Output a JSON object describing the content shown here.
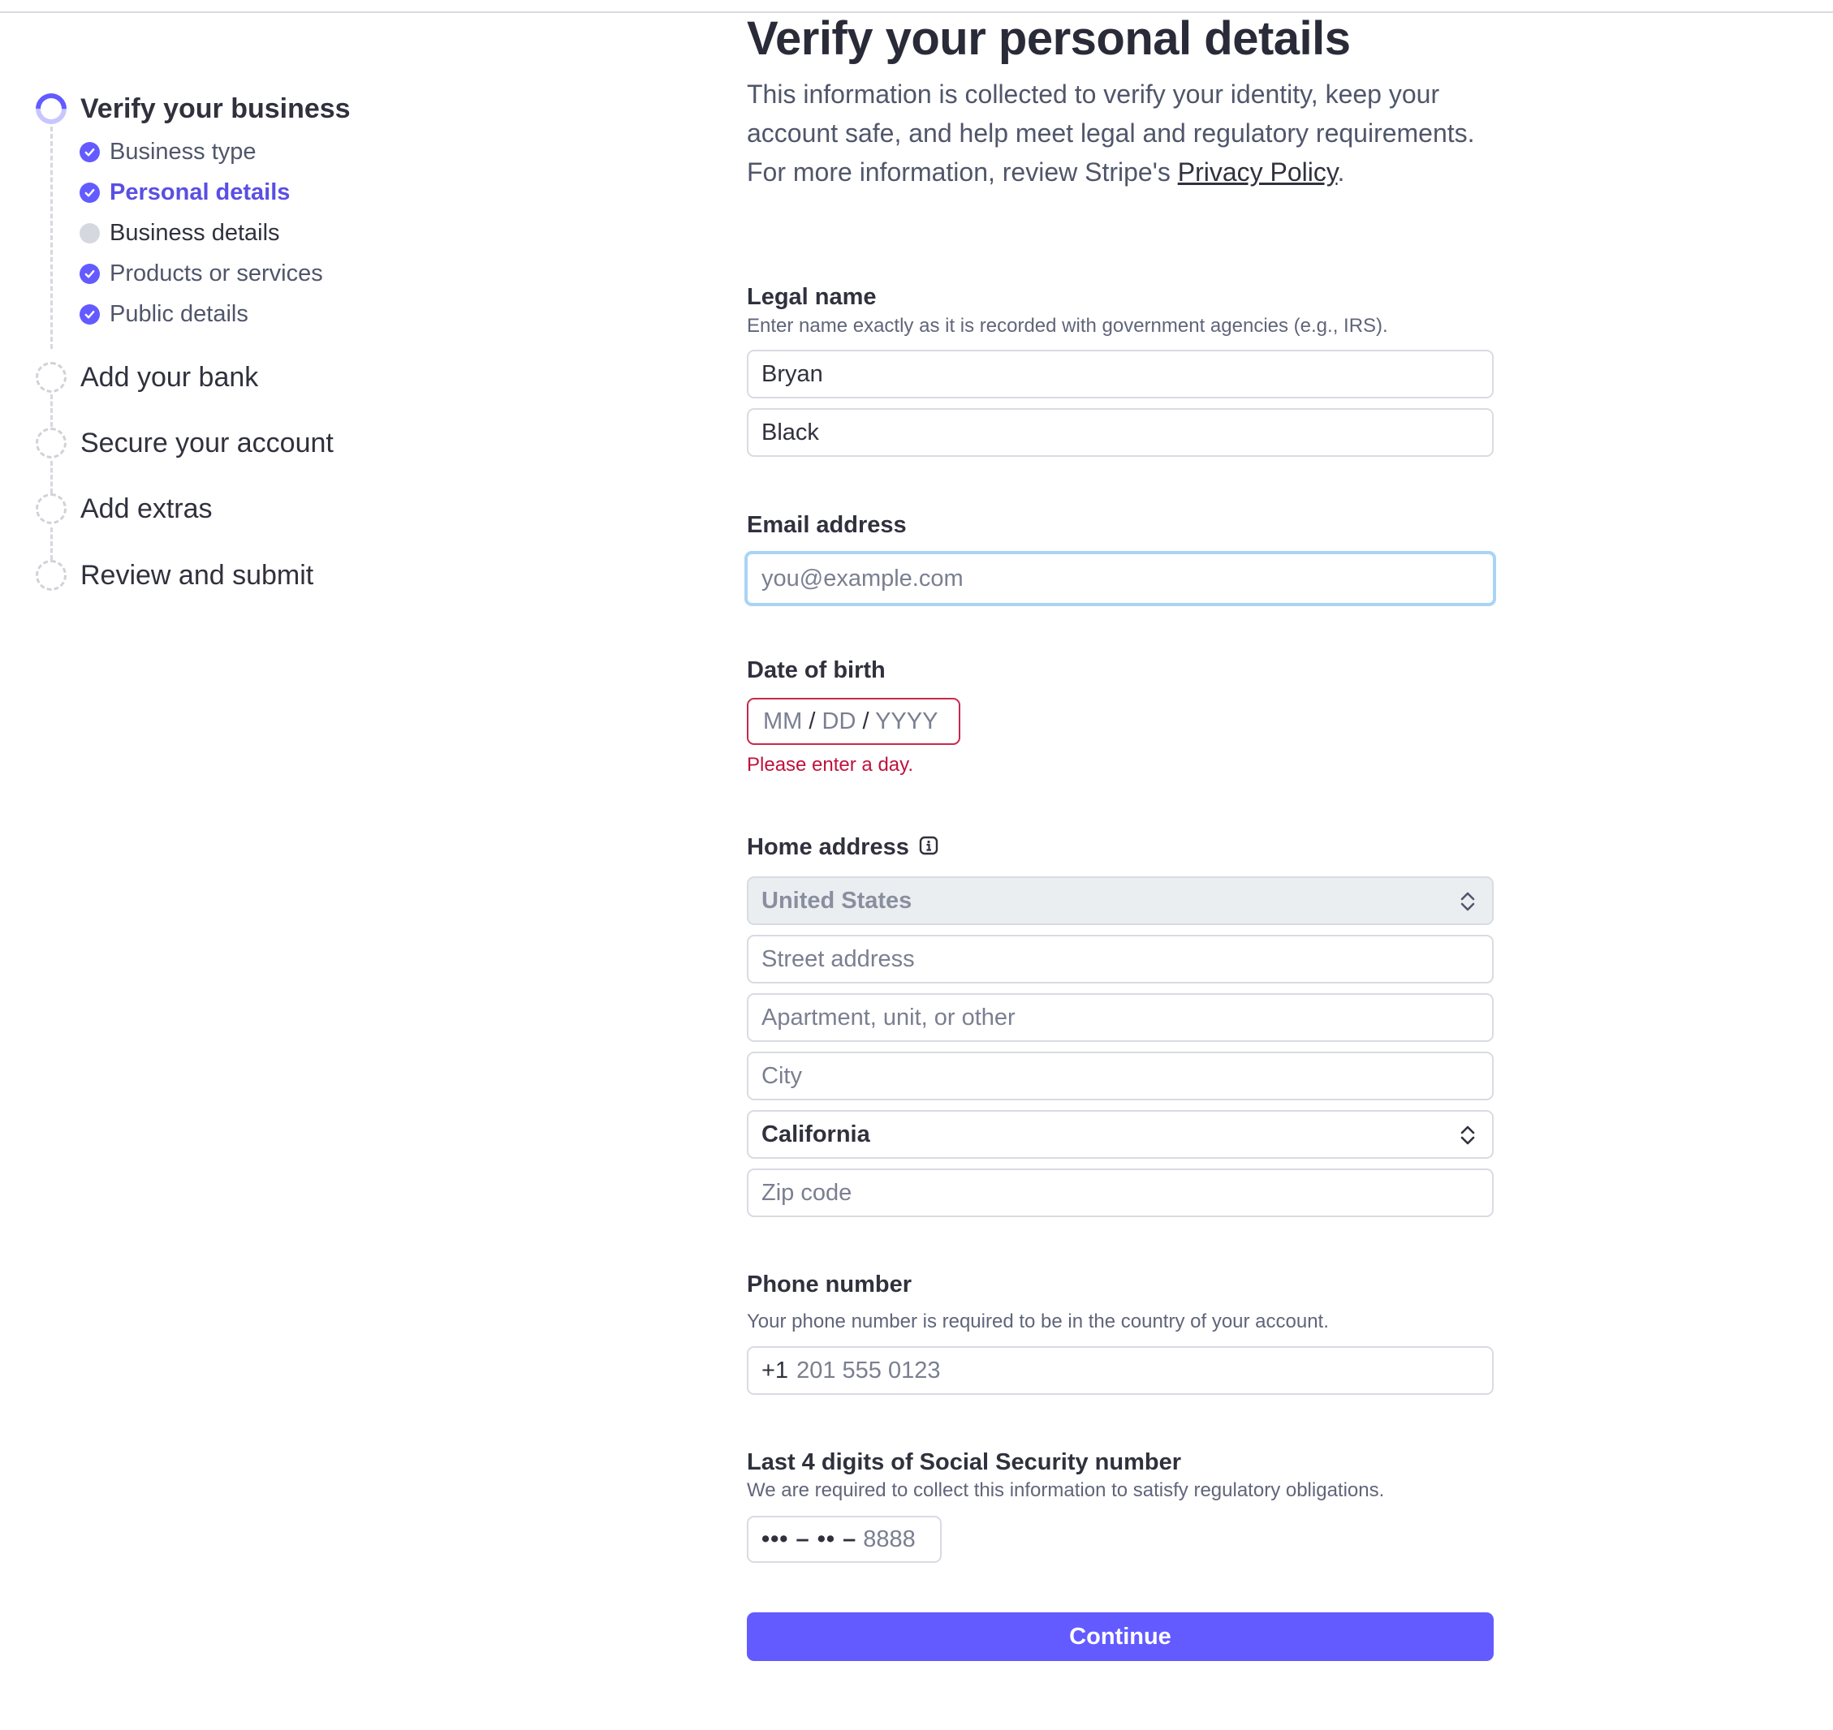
{
  "sidebar": {
    "steps": [
      {
        "label": "Verify your business",
        "state": "active"
      },
      {
        "label": "Add your bank",
        "state": "pending"
      },
      {
        "label": "Secure your account",
        "state": "pending"
      },
      {
        "label": "Add extras",
        "state": "pending"
      },
      {
        "label": "Review and submit",
        "state": "pending"
      }
    ],
    "substeps": [
      {
        "label": "Business type",
        "state": "done"
      },
      {
        "label": "Personal details",
        "state": "current"
      },
      {
        "label": "Business details",
        "state": "todo"
      },
      {
        "label": "Products or services",
        "state": "done"
      },
      {
        "label": "Public details",
        "state": "done"
      }
    ]
  },
  "main": {
    "title": "Verify your personal details",
    "intro_text": "This information is collected to verify your identity, keep your account safe, and help meet legal and regulatory requirements. For more information, review Stripe's",
    "intro_link": "Privacy Policy",
    "intro_end": ".",
    "legal_name": {
      "label": "Legal name",
      "help": "Enter name exactly as it is recorded with government agencies (e.g., IRS).",
      "first": "Bryan",
      "last": "Black"
    },
    "email": {
      "label": "Email address",
      "placeholder": "you@example.com"
    },
    "dob": {
      "label": "Date of birth",
      "mm": "MM",
      "dd": "DD",
      "yyyy": "YYYY",
      "sep": "/",
      "error": "Please enter a day."
    },
    "address": {
      "label": "Home address",
      "country": "United States",
      "street_placeholder": "Street address",
      "apt_placeholder": "Apartment, unit, or other",
      "city_placeholder": "City",
      "state": "California",
      "zip_placeholder": "Zip code"
    },
    "phone": {
      "label": "Phone number",
      "help": "Your phone number is required to be in the country of your account.",
      "prefix": "+1",
      "placeholder": "201 555 0123"
    },
    "ssn": {
      "label": "Last 4 digits of Social Security number",
      "help": "We are required to collect this information to satisfy regulatory obligations.",
      "mask": "••• – •• –",
      "placeholder": "8888"
    },
    "continue_label": "Continue"
  },
  "colors": {
    "accent": "#635bff",
    "error": "#c0123c",
    "focus_ring": "#a9d4f5"
  }
}
